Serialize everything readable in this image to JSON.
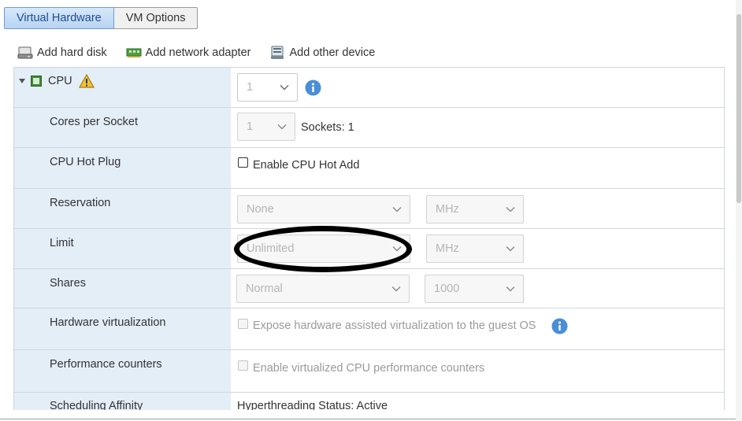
{
  "tabs": [
    {
      "label": "Virtual Hardware",
      "active": true
    },
    {
      "label": "VM Options",
      "active": false
    }
  ],
  "toolbar": {
    "add_hard_disk": "Add hard disk",
    "add_network_adapter": "Add network adapter",
    "add_other_device": "Add other device"
  },
  "cpu": {
    "label": "CPU",
    "value": "1",
    "cores_per_socket": {
      "label": "Cores per Socket",
      "value": "1",
      "sockets": "Sockets: 1"
    },
    "hot_plug": {
      "label": "CPU Hot Plug",
      "checkbox_label": "Enable CPU Hot Add",
      "checked": false
    },
    "reservation": {
      "label": "Reservation",
      "value": "None",
      "unit": "MHz"
    },
    "limit": {
      "label": "Limit",
      "value": "Unlimited",
      "unit": "MHz"
    },
    "shares": {
      "label": "Shares",
      "value": "Normal",
      "amount": "1000"
    },
    "hw_virt": {
      "label": "Hardware virtualization",
      "checkbox_label": "Expose hardware assisted virtualization to the guest OS",
      "checked": false
    },
    "perf_counters": {
      "label": "Performance counters",
      "checkbox_label": "Enable virtualized CPU performance counters",
      "checked": false
    },
    "affinity": {
      "label": "Scheduling Affinity",
      "value": "Hyperthreading Status: Active"
    }
  },
  "colors": {
    "label_bg": "#e3eef7",
    "tab_active": "#b8d3f2",
    "info_blue": "#4a8fd6",
    "warn_yellow": "#f2c233",
    "annotation": "#000000"
  },
  "icons": {
    "hard_disk": "hard-disk-icon",
    "network": "network-adapter-icon",
    "other": "other-device-icon",
    "cpu": "cpu-chip-icon",
    "warning": "warning-icon",
    "info": "info-icon"
  }
}
